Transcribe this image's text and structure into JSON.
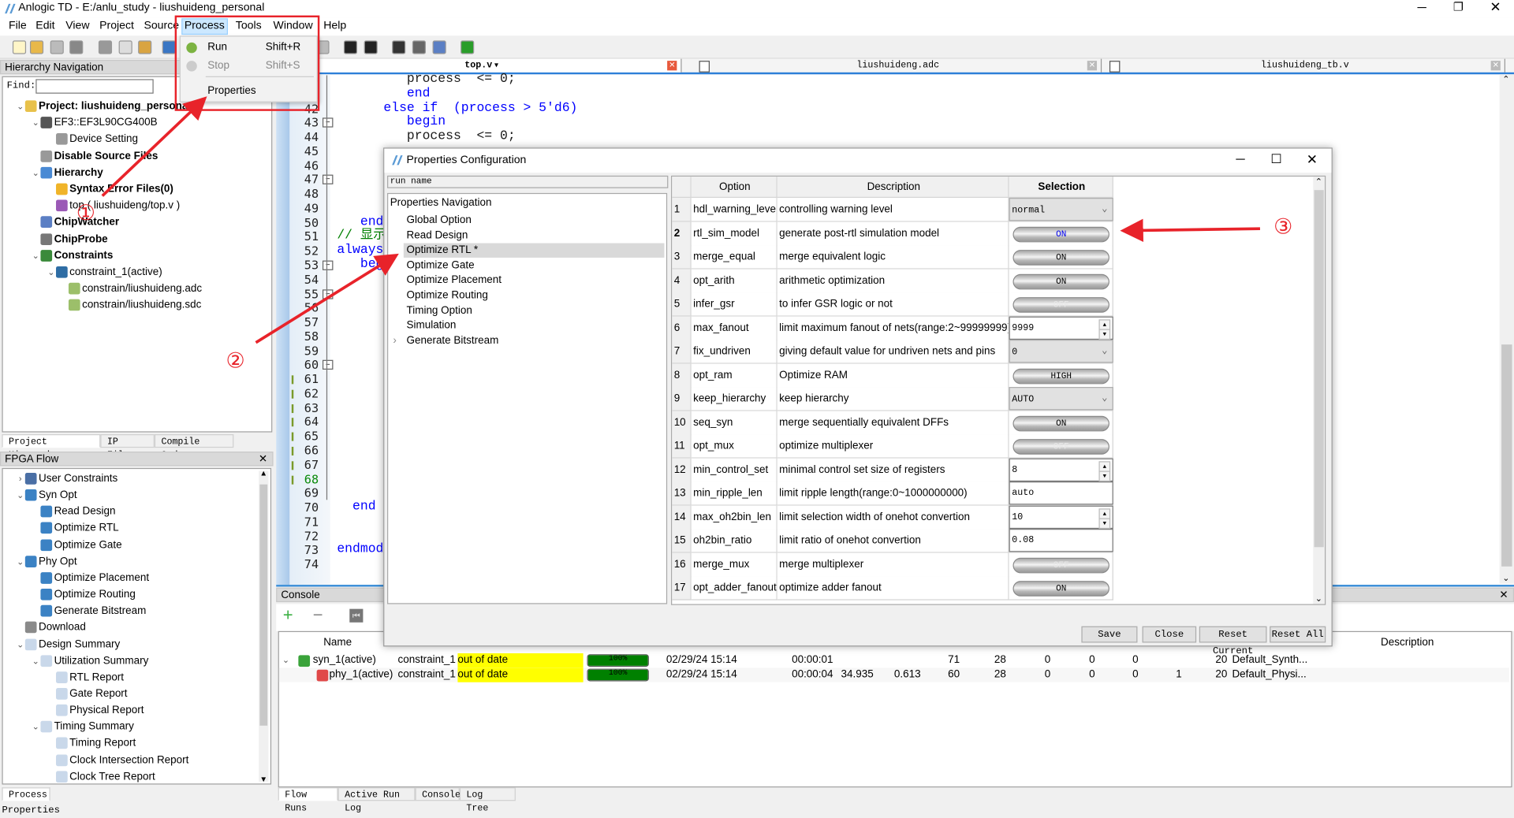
{
  "window": {
    "title": "Anlogic TD - E:/anlu_study - liushuideng_personal"
  },
  "menu": [
    "File",
    "Edit",
    "View",
    "Project",
    "Source",
    "Process",
    "Tools",
    "Window",
    "Help"
  ],
  "active_menu": "Process",
  "process_menu": {
    "items": [
      {
        "label": "Run",
        "shortcut": "Shift+R",
        "icon": "play-icon",
        "enabled": true
      },
      {
        "label": "Stop",
        "shortcut": "Shift+S",
        "icon": "stop-icon",
        "enabled": false
      },
      {
        "label": "Properties",
        "shortcut": "",
        "icon": "",
        "enabled": true
      }
    ]
  },
  "hierarchy": {
    "title": "Hierarchy Navigation",
    "find_label": "Find:",
    "find_value": "",
    "items": [
      {
        "label": "Project: liushuideng_personal",
        "level": 0,
        "chevron": "down",
        "bold": true,
        "icon": "folder-icon"
      },
      {
        "label": "EF3::EF3L90CG400B",
        "level": 1,
        "chevron": "down",
        "bold": false,
        "icon": "chip-icon"
      },
      {
        "label": "Device Setting",
        "level": 2,
        "chevron": "",
        "bold": false,
        "icon": "gears-icon"
      },
      {
        "label": "Disable Source Files",
        "level": 1,
        "chevron": "",
        "bold": true,
        "icon": "disabled-file-icon"
      },
      {
        "label": "Hierarchy",
        "level": 1,
        "chevron": "down",
        "bold": true,
        "icon": "hierarchy-icon"
      },
      {
        "label": "Syntax Error Files(0)",
        "level": 2,
        "chevron": "",
        "bold": true,
        "icon": "error-folder-icon"
      },
      {
        "label": "top ( liushuideng/top.v )",
        "level": 2,
        "chevron": "",
        "bold": false,
        "icon": "module-icon"
      },
      {
        "label": "ChipWatcher",
        "level": 1,
        "chevron": "",
        "bold": true,
        "icon": "waveform-icon"
      },
      {
        "label": "ChipProbe",
        "level": 1,
        "chevron": "",
        "bold": true,
        "icon": "probe-icon"
      },
      {
        "label": "Constraints",
        "level": 1,
        "chevron": "down",
        "bold": true,
        "icon": "constraints-folder-icon"
      },
      {
        "label": "constraint_1(active)",
        "level": 2,
        "chevron": "down",
        "bold": false,
        "icon": "constraint-icon"
      },
      {
        "label": "constrain/liushuideng.adc",
        "level": 3,
        "chevron": "",
        "bold": false,
        "icon": "file-icon"
      },
      {
        "label": "constrain/liushuideng.sdc",
        "level": 3,
        "chevron": "",
        "bold": false,
        "icon": "file-icon"
      }
    ],
    "tabs": [
      "Project Hierarchy",
      "IP Files",
      "Compile Order"
    ]
  },
  "fpga_flow": {
    "title": "FPGA Flow",
    "items": [
      {
        "label": "User Constraints",
        "level": 0,
        "chevron": "right",
        "icon": "gear-icon"
      },
      {
        "label": "Syn Opt",
        "level": 0,
        "chevron": "down",
        "icon": "flow-step-icon"
      },
      {
        "label": "Read Design",
        "level": 1,
        "chevron": "",
        "icon": "flow-step-icon"
      },
      {
        "label": "Optimize RTL",
        "level": 1,
        "chevron": "",
        "icon": "flow-step-icon"
      },
      {
        "label": "Optimize Gate",
        "level": 1,
        "chevron": "",
        "icon": "flow-step-icon"
      },
      {
        "label": "Phy Opt",
        "level": 0,
        "chevron": "down",
        "icon": "flow-step-icon"
      },
      {
        "label": "Optimize Placement",
        "level": 1,
        "chevron": "",
        "icon": "flow-step-icon"
      },
      {
        "label": "Optimize Routing",
        "level": 1,
        "chevron": "",
        "icon": "flow-step-icon"
      },
      {
        "label": "Generate Bitstream",
        "level": 1,
        "chevron": "",
        "icon": "flow-step-icon"
      },
      {
        "label": "Download",
        "level": 0,
        "chevron": "",
        "icon": "download-icon"
      },
      {
        "label": "Design Summary",
        "level": 0,
        "chevron": "down",
        "icon": "report-icon"
      },
      {
        "label": "Utilization Summary",
        "level": 1,
        "chevron": "down",
        "icon": "report-icon"
      },
      {
        "label": "RTL Report",
        "level": 2,
        "chevron": "",
        "icon": "report-icon"
      },
      {
        "label": "Gate Report",
        "level": 2,
        "chevron": "",
        "icon": "report-icon"
      },
      {
        "label": "Physical Report",
        "level": 2,
        "chevron": "",
        "icon": "report-icon"
      },
      {
        "label": "Timing Summary",
        "level": 1,
        "chevron": "down",
        "icon": "report-icon"
      },
      {
        "label": "Timing Report",
        "level": 2,
        "chevron": "",
        "icon": "report-icon"
      },
      {
        "label": "Clock Intersection Report",
        "level": 2,
        "chevron": "",
        "icon": "report-icon"
      },
      {
        "label": "Clock Tree Report",
        "level": 2,
        "chevron": "",
        "icon": "report-icon"
      }
    ],
    "tabs": [
      "Process"
    ]
  },
  "status_bar": {
    "text": "Properties"
  },
  "editor": {
    "tabs": [
      {
        "label": "top.v",
        "active": true
      },
      {
        "label": "liushuideng.adc",
        "active": false
      },
      {
        "label": "liushuideng_tb.v",
        "active": false
      }
    ],
    "first_line": 40,
    "last_line": 74,
    "modified_lines": [
      61,
      62,
      63,
      64,
      65,
      66,
      67,
      68
    ],
    "fold_lines": [
      43,
      47,
      53,
      55,
      60
    ],
    "lines": {
      "40": "         process  <= 0;",
      "41": "         end",
      "42": "      else if  (process > 5'd6)",
      "43": "         begin",
      "44": "         process  <= 0;",
      "50": "   end",
      "51": "// 显示",
      "52": "always",
      "53": "   begin",
      "70": "  end",
      "73": "endmodule"
    }
  },
  "console": {
    "title": "Console",
    "columns": {
      "name": "Name",
      "description": "Description"
    },
    "runs": [
      {
        "name": "syn_1(active)",
        "constraint": "constraint_1",
        "status": "out of date",
        "progress": 100,
        "progress_label": "100%",
        "date": "02/29/24 15:14",
        "elapsed": "00:00:01",
        "c1": "",
        "c2": "",
        "v1": "71",
        "v2": "28",
        "v3": "0",
        "v4": "0",
        "v5": "0",
        "v6": "",
        "v7": "20",
        "desc": "Default_Synth...",
        "icon": "synthesis-run-icon",
        "expanded": true
      },
      {
        "name": "phy_1(active)",
        "constraint": "constraint_1",
        "status": "out of date",
        "progress": 100,
        "progress_label": "100%",
        "date": "02/29/24 15:14",
        "elapsed": "00:00:04",
        "c1": "34.935",
        "c2": "0.613",
        "v1": "60",
        "v2": "28",
        "v3": "0",
        "v4": "0",
        "v5": "0",
        "v6": "1",
        "v7": "20",
        "desc": "Default_Physi...",
        "icon": "physical-run-icon",
        "expanded": false
      }
    ],
    "tabs": [
      "Flow Runs",
      "Active Run Log",
      "Console",
      "Log Tree"
    ]
  },
  "dialog": {
    "title": "Properties Configuration",
    "run_name": "run name",
    "nav_title": "Properties Navigation",
    "nav_items": [
      {
        "label": "Global Option",
        "selected": false,
        "expandable": false
      },
      {
        "label": "Read Design",
        "selected": false,
        "expandable": false
      },
      {
        "label": "Optimize RTL *",
        "selected": true,
        "expandable": false
      },
      {
        "label": "Optimize Gate",
        "selected": false,
        "expandable": false
      },
      {
        "label": "Optimize Placement",
        "selected": false,
        "expandable": false
      },
      {
        "label": "Optimize Routing",
        "selected": false,
        "expandable": false
      },
      {
        "label": "Timing Option",
        "selected": false,
        "expandable": false
      },
      {
        "label": "Simulation",
        "selected": false,
        "expandable": false
      },
      {
        "label": "Generate Bitstream",
        "selected": false,
        "expandable": true
      }
    ],
    "columns": [
      "Option",
      "Description",
      "Selection"
    ],
    "rows": [
      {
        "n": "1",
        "option": "hdl_warning_level",
        "desc": "controlling warning level",
        "type": "combo",
        "value": "normal"
      },
      {
        "n": "2",
        "option": "rtl_sim_model",
        "desc": "generate post-rtl simulation model",
        "type": "toggle",
        "value": "ON",
        "highlight": true
      },
      {
        "n": "3",
        "option": "merge_equal",
        "desc": "merge equivalent logic",
        "type": "toggle",
        "value": "ON"
      },
      {
        "n": "4",
        "option": "opt_arith",
        "desc": "arithmetic optimization",
        "type": "toggle",
        "value": "ON"
      },
      {
        "n": "5",
        "option": "infer_gsr",
        "desc": "to infer GSR logic or not",
        "type": "toggle",
        "value": "OFF"
      },
      {
        "n": "6",
        "option": "max_fanout",
        "desc": "limit maximum fanout of nets(range:2~99999999)",
        "type": "spin",
        "value": "9999"
      },
      {
        "n": "7",
        "option": "fix_undriven",
        "desc": "giving default value for undriven nets and pins",
        "type": "combo",
        "value": "0"
      },
      {
        "n": "8",
        "option": "opt_ram",
        "desc": "Optimize RAM",
        "type": "toggle",
        "value": "HIGH"
      },
      {
        "n": "9",
        "option": "keep_hierarchy",
        "desc": "keep hierarchy",
        "type": "combo",
        "value": "AUTO"
      },
      {
        "n": "10",
        "option": "seq_syn",
        "desc": "merge sequentially equivalent DFFs",
        "type": "toggle",
        "value": "ON"
      },
      {
        "n": "11",
        "option": "opt_mux",
        "desc": "optimize multiplexer",
        "type": "toggle",
        "value": "OFF"
      },
      {
        "n": "12",
        "option": "min_control_set",
        "desc": "minimal control set size of registers",
        "type": "spin",
        "value": "8"
      },
      {
        "n": "13",
        "option": "min_ripple_len",
        "desc": "limit ripple length(range:0~1000000000)",
        "type": "text",
        "value": "auto"
      },
      {
        "n": "14",
        "option": "max_oh2bin_len",
        "desc": "limit selection width of onehot convertion",
        "type": "spin",
        "value": "10"
      },
      {
        "n": "15",
        "option": "oh2bin_ratio",
        "desc": "limit ratio of onehot convertion",
        "type": "text",
        "value": "0.08"
      },
      {
        "n": "16",
        "option": "merge_mux",
        "desc": "merge multiplexer",
        "type": "toggle",
        "value": "OFF"
      },
      {
        "n": "17",
        "option": "opt_adder_fanout",
        "desc": "optimize adder fanout",
        "type": "toggle",
        "value": "ON"
      }
    ],
    "buttons": {
      "save": "Save",
      "close": "Close",
      "reset_current": "Reset Current",
      "reset_all": "Reset All"
    }
  },
  "annotations": {
    "one": "①",
    "two": "②",
    "three": "③",
    "color": "#e8232a"
  },
  "colors": {
    "status_out_of_date": "#ffff00",
    "progress_fill": "#008000",
    "selected_menu": "#cce8ff"
  }
}
